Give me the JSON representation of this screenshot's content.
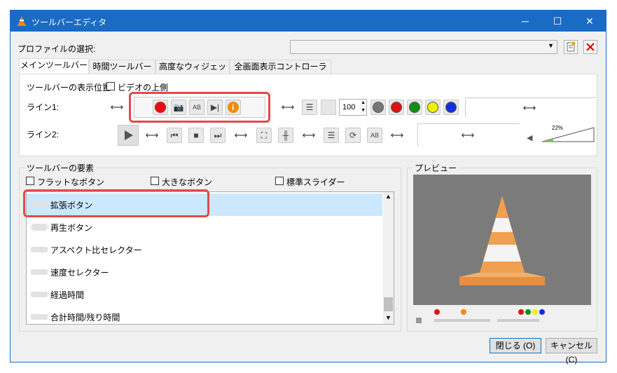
{
  "window": {
    "title": "ツールバーエディタ",
    "controls": {
      "minimize": "─",
      "maximize": "☐",
      "close": "✕"
    }
  },
  "profile": {
    "label": "プロファイルの選択:",
    "selected": "",
    "dropdown_glyph": "▼"
  },
  "tabs": [
    {
      "label": "メインツールバー"
    },
    {
      "label": "時間ツールバー"
    },
    {
      "label": "高度なウィジェット"
    },
    {
      "label": "全画面表示コントローラー"
    }
  ],
  "main_tab": {
    "position_label": "ツールバーの表示位置",
    "video_top_label": "ビデオの上側",
    "line1_label": "ライン1:",
    "line2_label": "ライン2:",
    "zoom_value": "100",
    "volume_percent": "22%"
  },
  "elements_group": {
    "title": "ツールバーの要素",
    "flat_buttons": "フラットなボタン",
    "big_buttons": "大きなボタン",
    "native_slider": "標準スライダー",
    "items": [
      {
        "label": "拡張ボタン"
      },
      {
        "label": "再生ボタン"
      },
      {
        "label": "アスペクト比セレクター"
      },
      {
        "label": "速度セレクター"
      },
      {
        "label": "経過時間"
      },
      {
        "label": "合計時間/残り時間"
      }
    ]
  },
  "preview": {
    "title": "プレビュー"
  },
  "footer": {
    "close_label": "閉じる (O)",
    "cancel_label": "キャンセル (C)"
  },
  "colors": {
    "titlebar": "#1a6bc4",
    "highlight": "#e24a4a",
    "selection": "#cce8ff",
    "record_red": "#e01010",
    "info_orange": "#f08a00",
    "cone_orange": "#f0a050"
  }
}
